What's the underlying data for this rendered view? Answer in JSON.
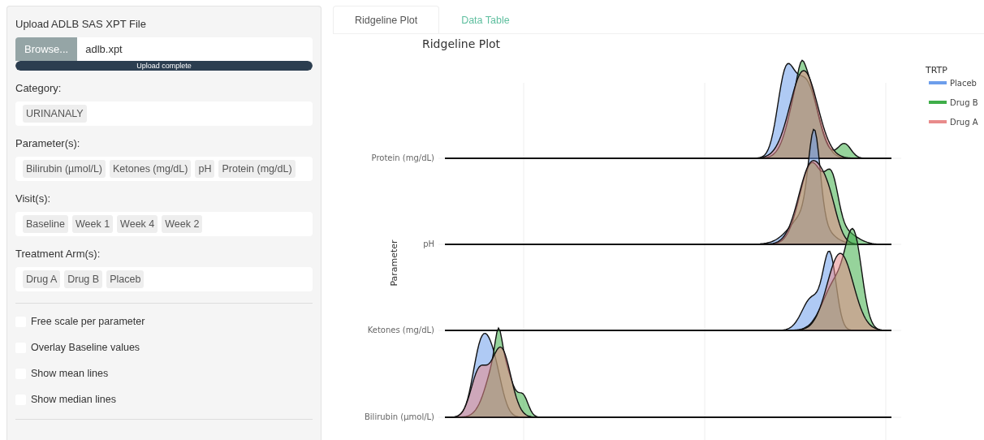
{
  "sidebar": {
    "upload": {
      "label": "Upload ADLB SAS XPT File",
      "button": "Browse...",
      "filename": "adlb.xpt",
      "progress": {
        "text": "Upload complete",
        "level": 1
      }
    },
    "selects": [
      {
        "label": "Category:",
        "tags": [
          "URINANALY"
        ]
      },
      {
        "label": "Parameter(s):",
        "tags": [
          "Bilirubin (µmol/L)",
          "Ketones (mg/dL)",
          "pH",
          "Protein (mg/dL)"
        ]
      },
      {
        "label": "Visit(s):",
        "tags": [
          "Baseline",
          "Week 1",
          "Week 4",
          "Week 2"
        ]
      },
      {
        "label": "Treatment Arm(s):",
        "tags": [
          "Drug A",
          "Drug B",
          "Placeb"
        ]
      }
    ],
    "checkboxes": [
      {
        "label": "Free scale per parameter",
        "checked": false
      },
      {
        "label": "Overlay Baseline values",
        "checked": false
      },
      {
        "label": "Show mean lines",
        "checked": false
      },
      {
        "label": "Show median lines",
        "checked": false
      }
    ]
  },
  "tabs": [
    {
      "label": "Ridgeline Plot",
      "selected": true
    },
    {
      "label": "Data Table",
      "selected": false
    }
  ],
  "plot": {
    "title": "Ridgeline Plot",
    "ylabel": "Parameter",
    "rows": [
      "Protein (mg/dL)",
      "pH",
      "Ketones (mg/dL)",
      "Bilirubin (µmol/L)"
    ],
    "legend": {
      "title": "TRTP",
      "items": [
        {
          "label": "Placeb",
          "color": "#6d9eeb"
        },
        {
          "label": "Drug B",
          "color": "#3fae49"
        },
        {
          "label": "Drug A",
          "color": "#e88b8b"
        }
      ]
    }
  }
}
